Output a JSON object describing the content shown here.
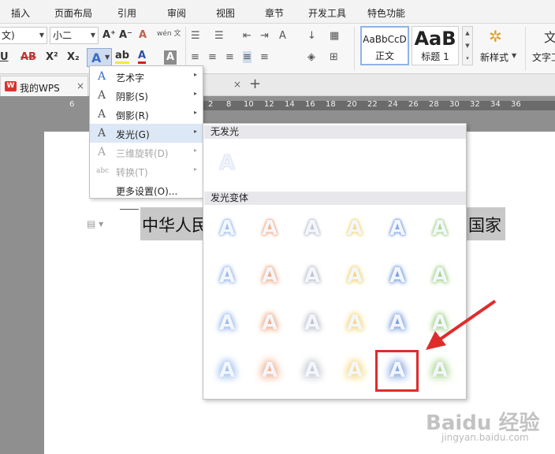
{
  "menu_tabs": [
    "插入",
    "页面布局",
    "引用",
    "审阅",
    "视图",
    "章节",
    "开发工具",
    "特色功能"
  ],
  "ribbon": {
    "font_name": "文)",
    "font_size": "小二",
    "grow_font": "A⁺",
    "shrink_font": "A⁻",
    "clear_format": "A",
    "phonetic": "wén 文",
    "underline": "U",
    "strikethrough": "AB",
    "superscript": "X²",
    "subscript": "X₂",
    "text_effect": "A",
    "highlight": "ab",
    "font_color": "A",
    "char_shading": "A",
    "styles": [
      {
        "sample": "AaBbCcD",
        "label": "正文"
      },
      {
        "sample": "AaB",
        "label": "标题 1"
      }
    ],
    "new_style": "新样式",
    "text_tool": "文字工"
  },
  "doc_tabs": {
    "wps_logo": "W",
    "wps_tab": "我的WPS",
    "close": "×",
    "add": "+"
  },
  "ruler_numbers": [
    "6",
    "2",
    "8",
    "10",
    "12",
    "14",
    "16",
    "18",
    "20",
    "22",
    "24",
    "26",
    "28",
    "30",
    "32",
    "34",
    "36"
  ],
  "document": {
    "text_left": "中华人民",
    "text_right": "国家"
  },
  "text_effect_menu": [
    {
      "icon": "A",
      "label": "艺术字",
      "arrow": "▸",
      "state": "normal"
    },
    {
      "icon": "A",
      "label": "阴影(S)",
      "arrow": "▸",
      "state": "normal"
    },
    {
      "icon": "A",
      "label": "倒影(R)",
      "arrow": "▸",
      "state": "normal"
    },
    {
      "icon": "A",
      "label": "发光(G)",
      "arrow": "▸",
      "state": "active"
    },
    {
      "icon": "A",
      "label": "三维旋转(D)",
      "arrow": "▸",
      "state": "disabled"
    },
    {
      "icon": "abc",
      "label": "转换(T)",
      "arrow": "▸",
      "state": "disabled"
    },
    {
      "icon": "",
      "label": "更多设置(O)...",
      "arrow": "",
      "state": "normal"
    }
  ],
  "glow_submenu": {
    "no_glow_header": "无发光",
    "variants_header": "发光变体",
    "glyph": "A",
    "glow_colors": [
      "#8fb4ea",
      "#f0a37a",
      "#b8bcc6",
      "#f2d36a",
      "#6f96dc",
      "#9ccf7c"
    ],
    "selected": {
      "row": 4,
      "col": 5
    }
  },
  "watermark": {
    "brand": "Baidu 经验",
    "url": "jingyan.baidu.com"
  }
}
